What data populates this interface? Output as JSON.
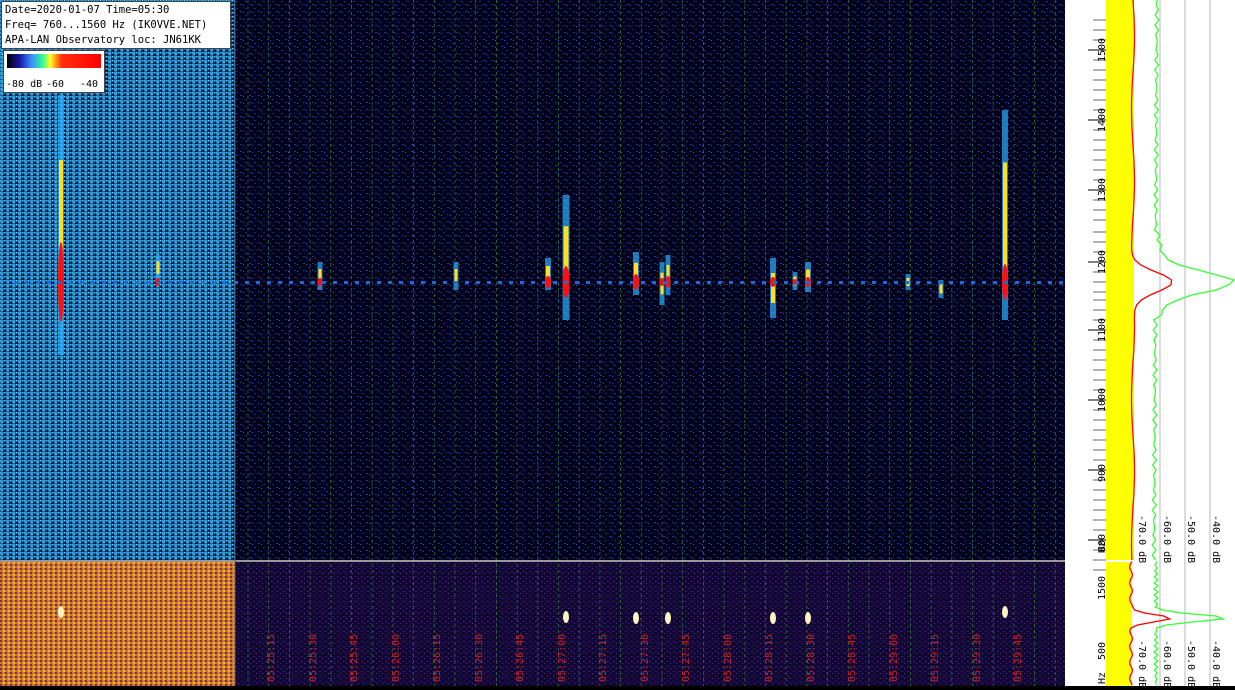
{
  "header": {
    "line1": "Date=2020-01-07 Time=05:30",
    "line2": "Freq= 760...1560 Hz (IK0VVE.NET)",
    "line3": "APA-LAN Observatory loc: JN61KK"
  },
  "color_scale": {
    "labels": [
      "-80 dB",
      "-60",
      "-40"
    ]
  },
  "freq_axis": {
    "unit": "Hz",
    "ticks": [
      "1500",
      "1400",
      "1300",
      "1200",
      "1100",
      "1000",
      "900",
      "800"
    ],
    "lower_ticks": [
      "1500",
      "500"
    ]
  },
  "spectrum_axis": {
    "db_labels": [
      "-70.0 dB",
      "-60.0 dB",
      "-50.0 dB",
      "-40.0 dB"
    ],
    "lower_db_labels": [
      "-70.0 dB",
      "-60.0 dB",
      "-50.0 dB",
      "-40.0 dB"
    ]
  },
  "time_axis": {
    "labels": [
      "05:25:15",
      "05:25:30",
      "05:25:45",
      "05:26:00",
      "05:26:15",
      "05:26:30",
      "05:26:45",
      "05:27:00",
      "05:27:15",
      "05:27:30",
      "05:27:45",
      "05:28:00",
      "05:28:15",
      "05:28:30",
      "05:28:45",
      "05:29:00",
      "05:29:15",
      "05:29:30",
      "05:29:45"
    ]
  },
  "colors": {
    "background": "#000010",
    "grid": "#2f7a2f",
    "spectrum_avg": "#ffff00",
    "spectrum_peak": "#ff0000",
    "spectrum_green": "#33ff33",
    "time_label": "#d02020"
  }
}
